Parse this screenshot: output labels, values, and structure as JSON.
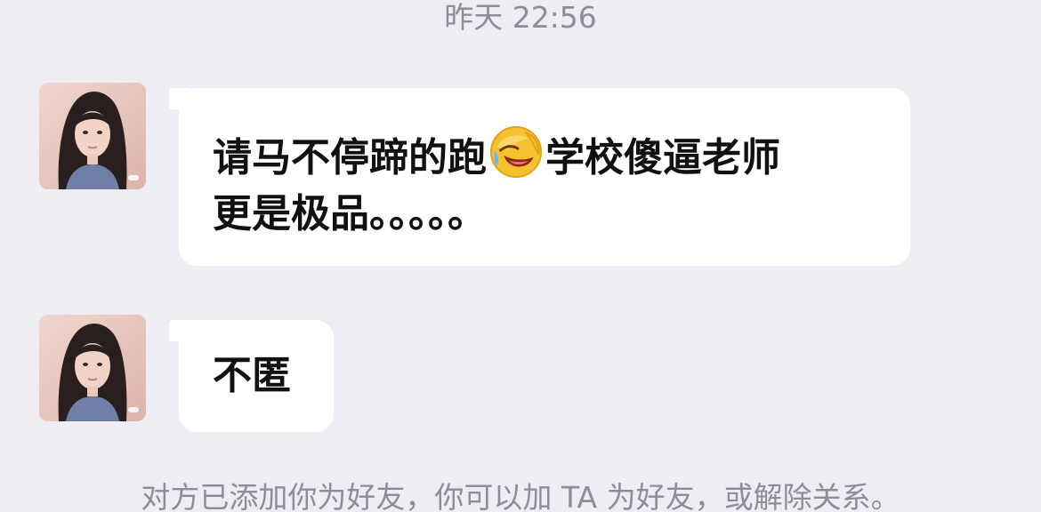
{
  "timestamp": "昨天 22:56",
  "messages": [
    {
      "sender": "contact",
      "text_line1_a": "请马不停蹄的跑",
      "emoji": "laughing-tears-emoji",
      "text_line1_b": "学校傻逼老师",
      "text_line2": "更是极品。。。。。"
    },
    {
      "sender": "contact",
      "text": "不匿"
    }
  ],
  "system_note": "对方已添加你为好友，你可以加 TA 为好友，或解除关系。",
  "colors": {
    "background": "#eeedf3",
    "bubble": "#ffffff",
    "meta_text": "#8e8d97",
    "message_text": "#111111"
  }
}
